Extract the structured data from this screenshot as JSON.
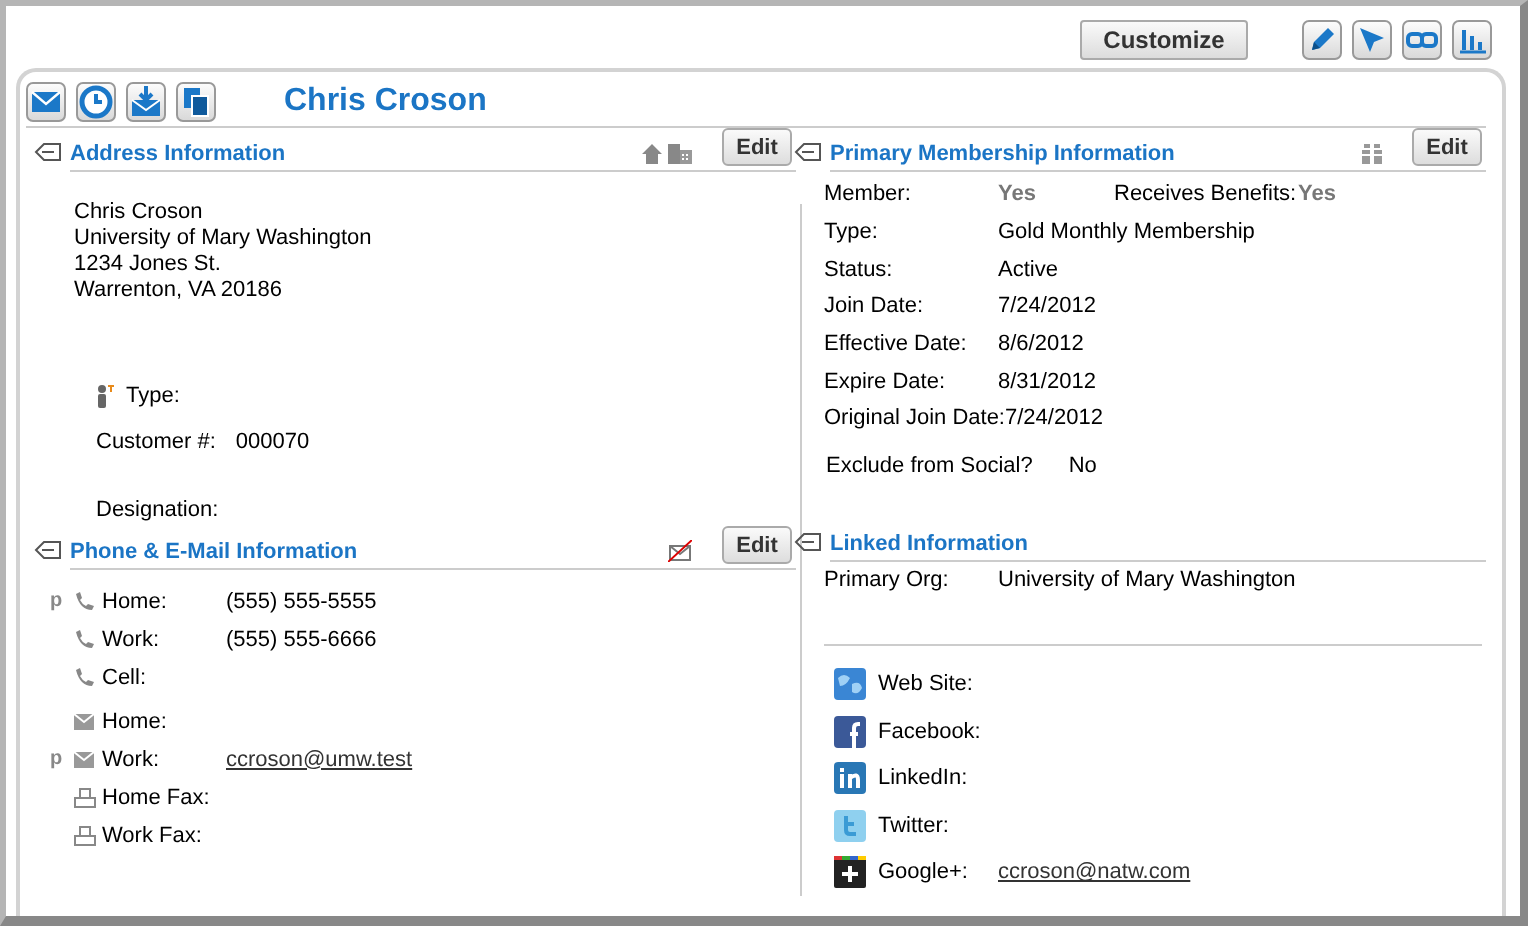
{
  "toolbar": {
    "customize_button": "Customize",
    "tools": [
      {
        "kind": "pencil"
      },
      {
        "kind": "cursor"
      },
      {
        "kind": "link"
      },
      {
        "kind": "chart"
      }
    ]
  },
  "header": {
    "actions": [
      {
        "kind": "mail"
      },
      {
        "kind": "clock"
      },
      {
        "kind": "inbox"
      },
      {
        "kind": "copy"
      }
    ],
    "title": "Chris Croson"
  },
  "address": {
    "title": "Address Information",
    "header_icons": [
      {
        "kind": "home"
      },
      {
        "kind": "building"
      }
    ],
    "edit_button": "Edit",
    "lines": [
      "Chris Croson",
      "University of Mary Washington",
      "1234 Jones St.",
      "Warrenton, VA 20186"
    ],
    "fields": [
      {
        "kind": "type",
        "label": "Type:"
      },
      {
        "kind": "plain",
        "label": "Customer #:",
        "value": "000070"
      },
      {
        "kind": "spaced",
        "label": "Designation:"
      }
    ]
  },
  "phone_email": {
    "title": "Phone & E-Mail Information",
    "header_icons": [
      {
        "kind": "no-mail"
      }
    ],
    "edit_button": "Edit",
    "rows": [
      {
        "kind": "phone",
        "marker": "p",
        "label": "Home:",
        "value": "(555) 555-5555",
        "link": false
      },
      {
        "kind": "phone",
        "label": "Work:",
        "value": "(555) 555-6666",
        "link": false
      },
      {
        "kind": "phone",
        "label": "Cell:"
      },
      {
        "kind": "mail",
        "label": "Home:"
      },
      {
        "kind": "mail",
        "marker": "p",
        "label": "Work:",
        "value": "ccroson@umw.test",
        "link": true
      },
      {
        "kind": "fax",
        "label": "Home Fax:"
      },
      {
        "kind": "fax",
        "label": "Work Fax:"
      }
    ]
  },
  "membership": {
    "title": "Primary Membership Information",
    "header_icons": [
      {
        "kind": "gift"
      }
    ],
    "edit_button": "Edit",
    "rows": [
      {
        "label": "Member:",
        "value": "Yes",
        "muted": true,
        "extra_label": "Receives Benefits:",
        "extra_value": "Yes"
      },
      {
        "label": "Type:",
        "value": "Gold Monthly Membership",
        "muted": false
      },
      {
        "label": "Status:",
        "value": "Active",
        "muted": false
      },
      {
        "label": "Join Date:",
        "value": "7/24/2012",
        "muted": false
      },
      {
        "label": "Effective Date:",
        "value": "8/6/2012",
        "muted": false
      },
      {
        "label": "Expire Date:",
        "value": "8/31/2012",
        "muted": false
      },
      {
        "label": "Original Join Date:",
        "value": "7/24/2012",
        "muted": false
      }
    ],
    "exclude": {
      "label": "Exclude from Social?",
      "value": "No"
    }
  },
  "linked": {
    "title": "Linked Information",
    "rows": [
      {
        "label": "Primary Org:",
        "value": "University of Mary Washington"
      }
    ],
    "social": [
      {
        "kind": "web",
        "label": "Web Site:"
      },
      {
        "kind": "facebook",
        "label": "Facebook:"
      },
      {
        "kind": "linkedin",
        "label": "LinkedIn:"
      },
      {
        "kind": "twitter",
        "label": "Twitter:"
      },
      {
        "kind": "google",
        "label": "Google+:",
        "value": "ccroson@natw.com"
      }
    ]
  }
}
